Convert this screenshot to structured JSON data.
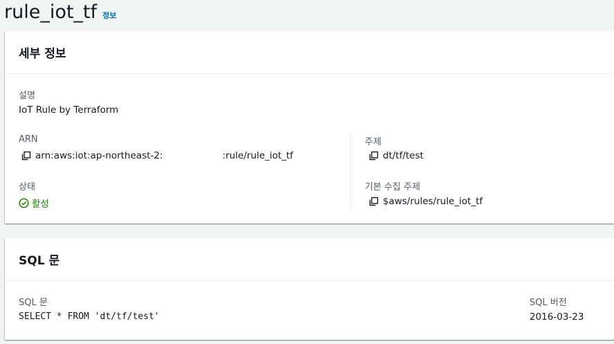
{
  "header": {
    "title": "rule_iot_tf",
    "info_label": "정보"
  },
  "details": {
    "title": "세부 정보",
    "description_label": "설명",
    "description_value": "IoT Rule by Terraform",
    "arn_label": "ARN",
    "arn_prefix": "arn:aws:iot:ap-northeast-2:",
    "arn_suffix": ":rule/rule_iot_tf",
    "status_label": "상태",
    "status_value": "활성",
    "topic_label": "주제",
    "topic_value": "dt/tf/test",
    "base_topic_label": "기본 수집 주제",
    "base_topic_value": "$aws/rules/rule_iot_tf"
  },
  "sql": {
    "title": "SQL 문",
    "statement_label": "SQL 문",
    "statement_value": "SELECT * FROM 'dt/tf/test'",
    "version_label": "SQL 버전",
    "version_value": "2016-03-23"
  },
  "colors": {
    "accent": "#0073bb",
    "status_ok": "#1d8102",
    "label": "#545b64"
  },
  "icons": {
    "copy": "copy-icon",
    "status": "status-positive-icon"
  }
}
